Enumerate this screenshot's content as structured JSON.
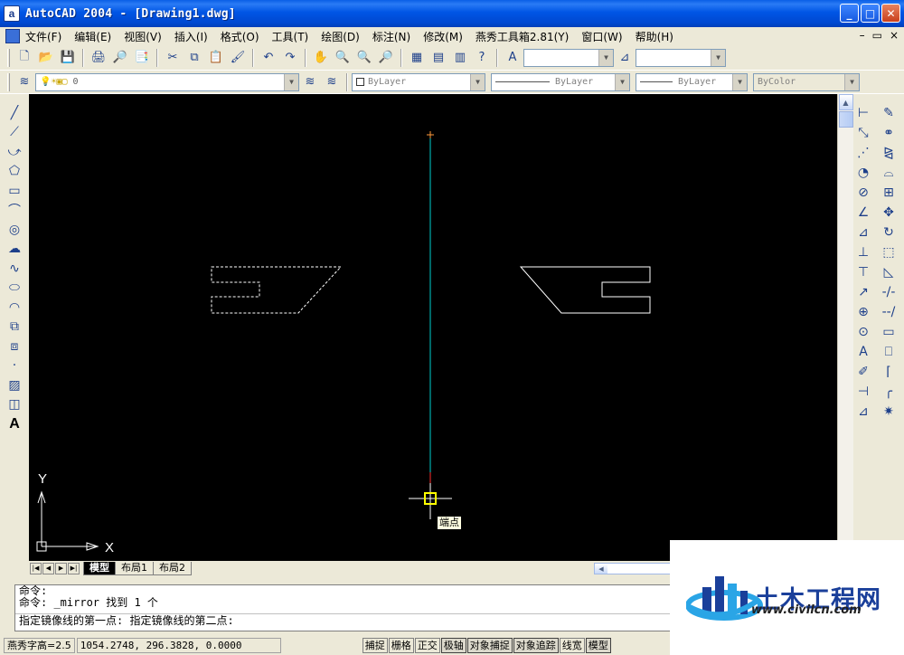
{
  "window": {
    "title": "AutoCAD 2004 - [Drawing1.dwg]",
    "app_icon": "a"
  },
  "window_buttons": {
    "minimize": "_",
    "maximize": "□",
    "close": "✕"
  },
  "menu": {
    "items": [
      "文件(F)",
      "编辑(E)",
      "视图(V)",
      "插入(I)",
      "格式(O)",
      "工具(T)",
      "绘图(D)",
      "标注(N)",
      "修改(M)",
      "燕秀工具箱2.81(Y)",
      "窗口(W)",
      "帮助(H)"
    ],
    "mdi_buttons": [
      "–",
      "▭",
      "×"
    ]
  },
  "layer_toolbar": {
    "current_layer": "0"
  },
  "properties_toolbar": {
    "color": "ByLayer",
    "linetype": "ByLayer",
    "lineweight": "ByLayer",
    "plotstyle": "ByColor"
  },
  "canvas": {
    "ucs_y": "Y",
    "ucs_x": "X",
    "osnap_tooltip": "端点"
  },
  "layout_tabs": {
    "tabs": [
      "模型",
      "布局1",
      "布局2"
    ],
    "active": "模型"
  },
  "command_lines": [
    "命令:",
    "命令: _mirror 找到 1 个",
    "指定镜像线的第一点: 指定镜像线的第二点:"
  ],
  "status_bar": {
    "text_height": "燕秀字高=2.5",
    "coordinates": "1054.2748, 296.3828, 0.0000",
    "toggles": [
      "捕捉",
      "栅格",
      "正交",
      "极轴",
      "对象捕捉",
      "对象追踪",
      "线宽",
      "模型"
    ]
  },
  "watermark": {
    "name": "土木工程网",
    "url": "www.civilcn.com"
  },
  "colors": {
    "titlebar": "#0055e5",
    "canvas_bg": "#000000",
    "mirror_line": "#00d0d0",
    "geometry": "#ffffff",
    "snap_marker": "#ffff00"
  }
}
